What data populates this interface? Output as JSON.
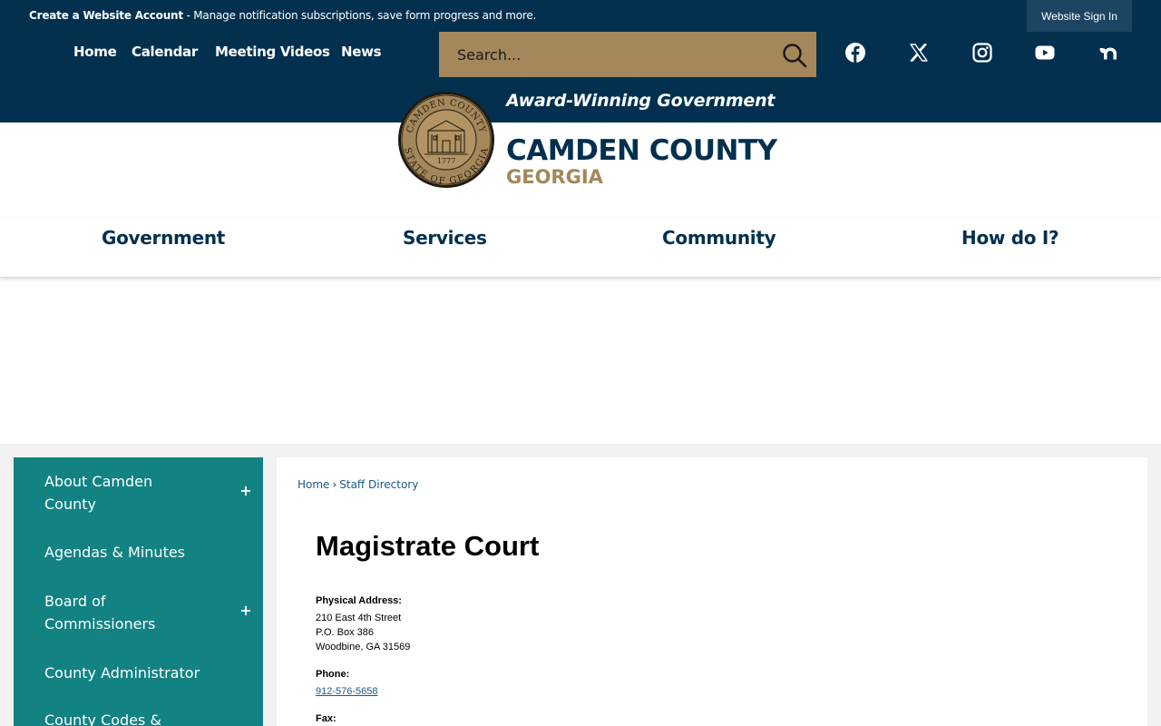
{
  "colors": {
    "navy": "#03304f",
    "gold": "#a4875a",
    "teal": "#128283",
    "link": "#1c5a85"
  },
  "top_bar": {
    "create_account": "Create a Website Account",
    "notice": " - Manage notification subscriptions, save form progress and more.",
    "sign_in": "Website Sign In"
  },
  "top_nav": [
    "Home",
    "Calendar",
    "Meeting Videos",
    "News"
  ],
  "search": {
    "placeholder": "Search..."
  },
  "social_icons": [
    "facebook-icon",
    "x-icon",
    "instagram-icon",
    "youtube-icon",
    "nextdoor-icon"
  ],
  "header": {
    "tagline": "Award-Winning Government",
    "county": "CAMDEN COUNTY",
    "state": "GEORGIA",
    "seal_top": "CAMDEN COUNTY",
    "seal_bottom": "STATE OF GEORGIA",
    "seal_year": "1777"
  },
  "main_nav": [
    "Government",
    "Services",
    "Community",
    "How do I?"
  ],
  "sidebar": {
    "items": [
      {
        "line1": "About Camden",
        "line2": "County",
        "expandable": true
      },
      {
        "line1": "Agendas & Minutes",
        "line2": "",
        "expandable": false
      },
      {
        "line1": "Board of",
        "line2": "Commissioners",
        "expandable": true
      },
      {
        "line1": "County Administrator",
        "line2": "",
        "expandable": false
      },
      {
        "line1": "County Codes &",
        "line2": "",
        "expandable": false
      }
    ],
    "expand_symbol": "+"
  },
  "breadcrumb": {
    "home": "Home",
    "sep": "›",
    "current": "Staff Directory"
  },
  "page": {
    "title": "Magistrate Court",
    "address_label": "Physical Address:",
    "address": [
      "210 East 4th Street",
      "P.O. Box 386",
      "Woodbine, GA 31569"
    ],
    "phone_label": "Phone:",
    "phone": "912-576-5658",
    "fax_label": "Fax:"
  }
}
